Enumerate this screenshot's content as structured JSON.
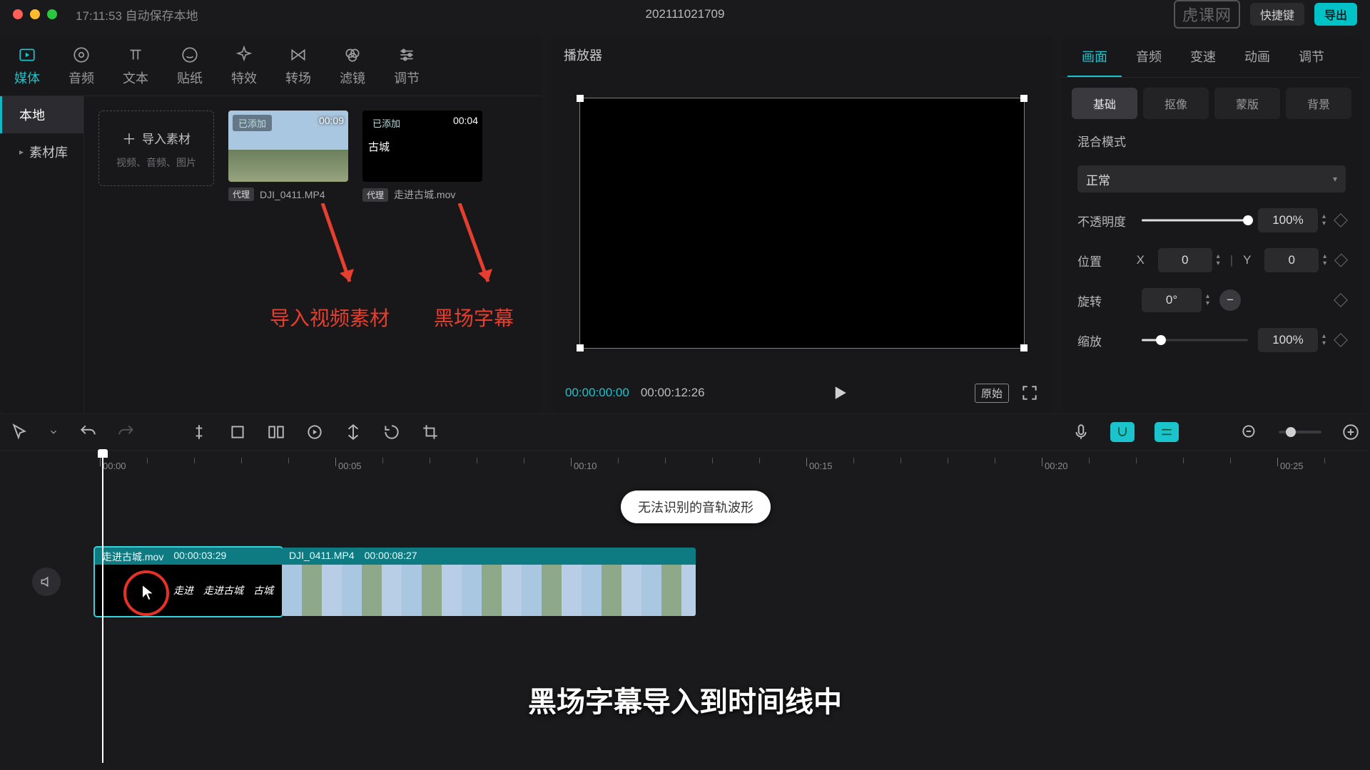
{
  "titlebar": {
    "autosave": "17:11:53 自动保存本地",
    "project": "202111021709",
    "shortcut": "快捷键",
    "export": "导出",
    "logo": "虎课网"
  },
  "topTabs": [
    {
      "id": "media",
      "label": "媒体"
    },
    {
      "id": "audio",
      "label": "音频"
    },
    {
      "id": "text",
      "label": "文本"
    },
    {
      "id": "sticker",
      "label": "贴纸"
    },
    {
      "id": "effect",
      "label": "特效"
    },
    {
      "id": "transition",
      "label": "转场"
    },
    {
      "id": "filter",
      "label": "滤镜"
    },
    {
      "id": "adjust",
      "label": "调节"
    }
  ],
  "side": {
    "local": "本地",
    "library": "素材库"
  },
  "importer": {
    "label": "导入素材",
    "sub": "视频、音频、图片"
  },
  "clips": [
    {
      "tag": "已添加",
      "dur": "00:09",
      "proxy": "代理",
      "name": "DJI_0411.MP4",
      "kind": "sky"
    },
    {
      "tag": "已添加",
      "dur": "00:04",
      "proxy": "代理",
      "name": "走进古城.mov",
      "kind": "black",
      "inner": "古城"
    }
  ],
  "annot": {
    "a": "导入视频素材",
    "b": "黑场字幕"
  },
  "player": {
    "title": "播放器",
    "pos": "00:00:00:00",
    "total": "00:00:12:26",
    "original": "原始"
  },
  "inspector": {
    "tabs": [
      "画面",
      "音频",
      "变速",
      "动画",
      "调节"
    ],
    "subtabs": [
      "基础",
      "抠像",
      "蒙版",
      "背景"
    ],
    "blendLabel": "混合模式",
    "blendValue": "正常",
    "opacityLabel": "不透明度",
    "opacityValue": "100%",
    "posLabel": "位置",
    "x": "X",
    "xv": "0",
    "y": "Y",
    "yv": "0",
    "rotLabel": "旋转",
    "rotValue": "0°",
    "scaleLabel": "缩放",
    "scaleValue": "100%"
  },
  "ruler": {
    "ticks": [
      "00:00",
      "00:05",
      "00:10",
      "00:15",
      "00:20",
      "00:25"
    ]
  },
  "note": "无法识别的音轨波形",
  "timelineClips": [
    {
      "name": "走进古城.mov",
      "dur": "00:00:03:29",
      "words": [
        "走进",
        "走进古城",
        "古城"
      ]
    },
    {
      "name": "DJI_0411.MP4",
      "dur": "00:00:08:27"
    }
  ],
  "caption": "黑场字幕导入到时间线中"
}
